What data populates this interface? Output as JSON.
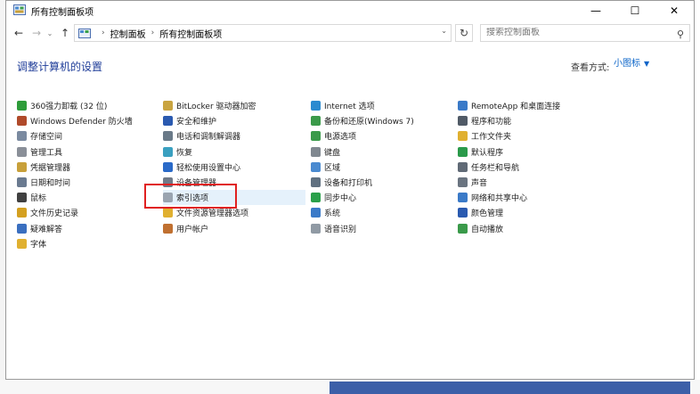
{
  "window": {
    "title": "所有控制面板项",
    "minimize_glyph": "—",
    "maximize_glyph": "☐",
    "close_glyph": "✕"
  },
  "nav": {
    "back_glyph": "←",
    "forward_glyph": "→",
    "history_glyph": "⌄",
    "up_glyph": "↑",
    "breadcrumb": [
      "控制面板",
      "所有控制面板项"
    ],
    "breadcrumb_sep": "›",
    "refresh_glyph": "↻",
    "search_placeholder": "搜索控制面板",
    "search_glyph": "⚲"
  },
  "header": {
    "title": "调整计算机的设置",
    "view_by_label": "查看方式:",
    "view_by_value": "小图标"
  },
  "columns": [
    [
      {
        "label": "360强力卸载 (32 位)",
        "icon": "uninstall-icon",
        "color": "#2e9c3a"
      },
      {
        "label": "Windows Defender 防火墙",
        "icon": "firewall-icon",
        "color": "#b04a2a"
      },
      {
        "label": "存储空间",
        "icon": "storage-icon",
        "color": "#7a8aa0"
      },
      {
        "label": "管理工具",
        "icon": "admin-tools-icon",
        "color": "#8a8f98"
      },
      {
        "label": "凭据管理器",
        "icon": "credential-icon",
        "color": "#c8a03a"
      },
      {
        "label": "日期和时间",
        "icon": "clock-icon",
        "color": "#6a7a90"
      },
      {
        "label": "鼠标",
        "icon": "mouse-icon",
        "color": "#404040"
      },
      {
        "label": "文件历史记录",
        "icon": "file-history-icon",
        "color": "#d4a020"
      },
      {
        "label": "疑难解答",
        "icon": "troubleshoot-icon",
        "color": "#3a6fc0"
      },
      {
        "label": "字体",
        "icon": "font-icon",
        "color": "#e0b030"
      }
    ],
    [
      {
        "label": "BitLocker 驱动器加密",
        "icon": "bitlocker-icon",
        "color": "#c9a440"
      },
      {
        "label": "安全和维护",
        "icon": "flag-icon",
        "color": "#2a5ab0"
      },
      {
        "label": "电话和调制解调器",
        "icon": "phone-icon",
        "color": "#6a7a88"
      },
      {
        "label": "恢复",
        "icon": "recovery-icon",
        "color": "#3aa0c0"
      },
      {
        "label": "轻松使用设置中心",
        "icon": "ease-access-icon",
        "color": "#2a6ac8"
      },
      {
        "label": "设备管理器",
        "icon": "device-manager-icon",
        "color": "#707a88"
      },
      {
        "label": "索引选项",
        "icon": "indexing-icon",
        "color": "#9aa4b0"
      },
      {
        "label": "文件资源管理器选项",
        "icon": "folder-options-icon",
        "color": "#e0b030"
      },
      {
        "label": "用户帐户",
        "icon": "user-accounts-icon",
        "color": "#c07030"
      }
    ],
    [
      {
        "label": "Internet 选项",
        "icon": "internet-icon",
        "color": "#2a8ad0"
      },
      {
        "label": "备份和还原(Windows 7)",
        "icon": "backup-icon",
        "color": "#3a9a4a"
      },
      {
        "label": "电源选项",
        "icon": "power-icon",
        "color": "#3a9a4a"
      },
      {
        "label": "键盘",
        "icon": "keyboard-icon",
        "color": "#808890"
      },
      {
        "label": "区域",
        "icon": "region-icon",
        "color": "#4a8ad0"
      },
      {
        "label": "设备和打印机",
        "icon": "printer-icon",
        "color": "#607080"
      },
      {
        "label": "同步中心",
        "icon": "sync-icon",
        "color": "#2aa04a"
      },
      {
        "label": "系统",
        "icon": "system-icon",
        "color": "#3a7ac8"
      },
      {
        "label": "语音识别",
        "icon": "microphone-icon",
        "color": "#909aa4"
      }
    ],
    [
      {
        "label": "RemoteApp 和桌面连接",
        "icon": "remoteapp-icon",
        "color": "#3a7ac8"
      },
      {
        "label": "程序和功能",
        "icon": "programs-icon",
        "color": "#505a66"
      },
      {
        "label": "工作文件夹",
        "icon": "work-folders-icon",
        "color": "#e0b030"
      },
      {
        "label": "默认程序",
        "icon": "default-programs-icon",
        "color": "#2a9a4a"
      },
      {
        "label": "任务栏和导航",
        "icon": "taskbar-icon",
        "color": "#606a76"
      },
      {
        "label": "声音",
        "icon": "sound-icon",
        "color": "#6a7480"
      },
      {
        "label": "网络和共享中心",
        "icon": "network-icon",
        "color": "#3a7ac8"
      },
      {
        "label": "颜色管理",
        "icon": "color-management-icon",
        "color": "#2a5ab0"
      },
      {
        "label": "自动播放",
        "icon": "autoplay-icon",
        "color": "#3a9a4a"
      }
    ]
  ],
  "selected_item": "索引选项",
  "accent_color": "#1f3d99",
  "link_color": "#0a64c8",
  "highlight_color": "#e02020"
}
